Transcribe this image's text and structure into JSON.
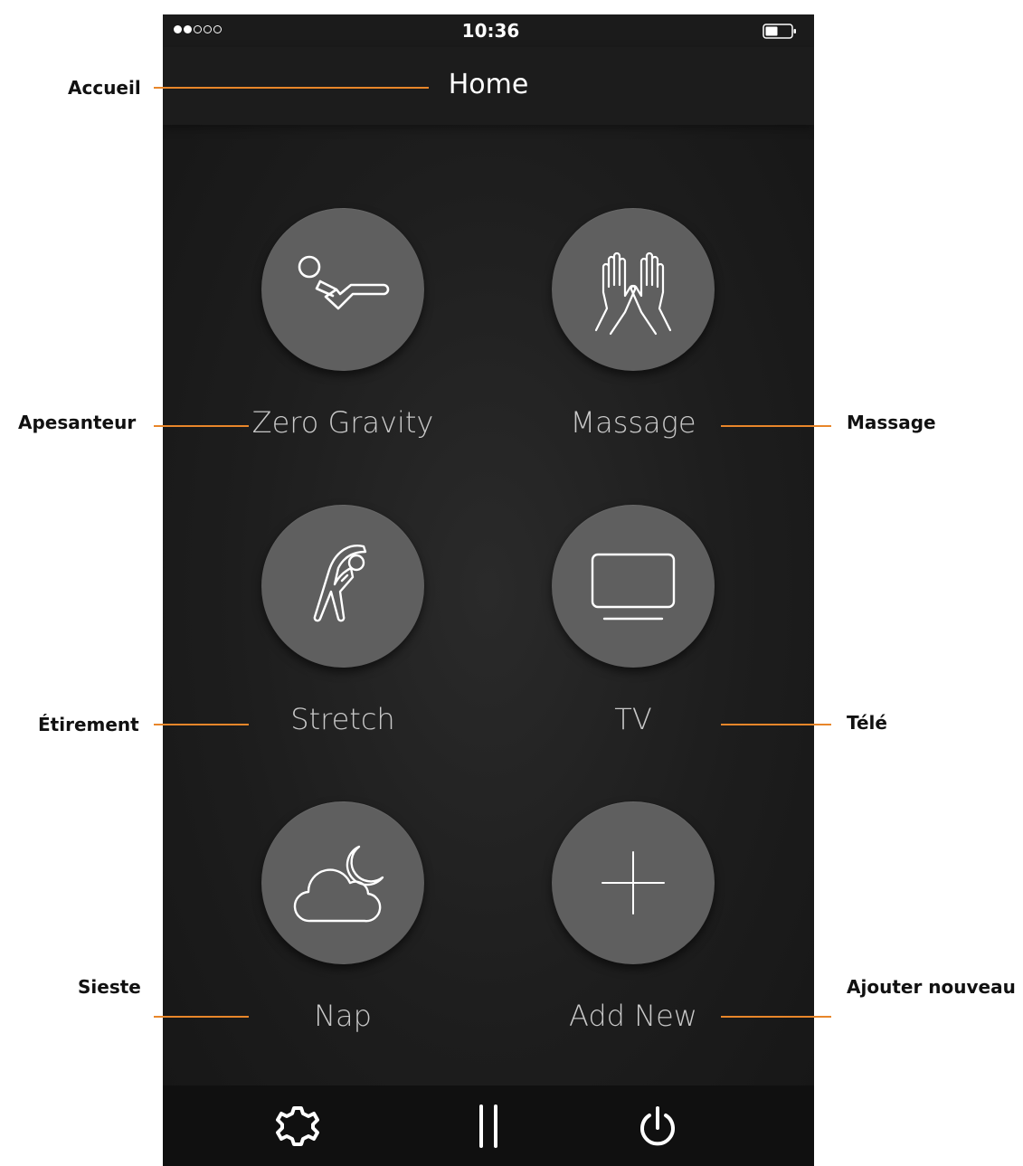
{
  "status_bar": {
    "time": "10:36"
  },
  "nav": {
    "title": "Home"
  },
  "tiles": [
    {
      "label": "Zero Gravity",
      "icon": "zero-gravity-icon"
    },
    {
      "label": "Massage",
      "icon": "hands-icon"
    },
    {
      "label": "Stretch",
      "icon": "stretch-icon"
    },
    {
      "label": "TV",
      "icon": "tv-icon"
    },
    {
      "label": "Nap",
      "icon": "cloud-moon-icon"
    },
    {
      "label": "Add New",
      "icon": "plus-icon"
    }
  ],
  "toolbar": {
    "icons": [
      "gear-icon",
      "pause-icon",
      "power-icon"
    ]
  },
  "callouts": {
    "home": "Accueil",
    "zero_gravity": "Apesanteur",
    "massage": "Massage",
    "stretch": "Étirement",
    "tv": "Télé",
    "nap": "Sieste",
    "add_new": "Ajouter nouveau"
  },
  "colors": {
    "callout_line": "#e8862a",
    "button": "#5f5f5f",
    "background": "#1d1d1d"
  }
}
